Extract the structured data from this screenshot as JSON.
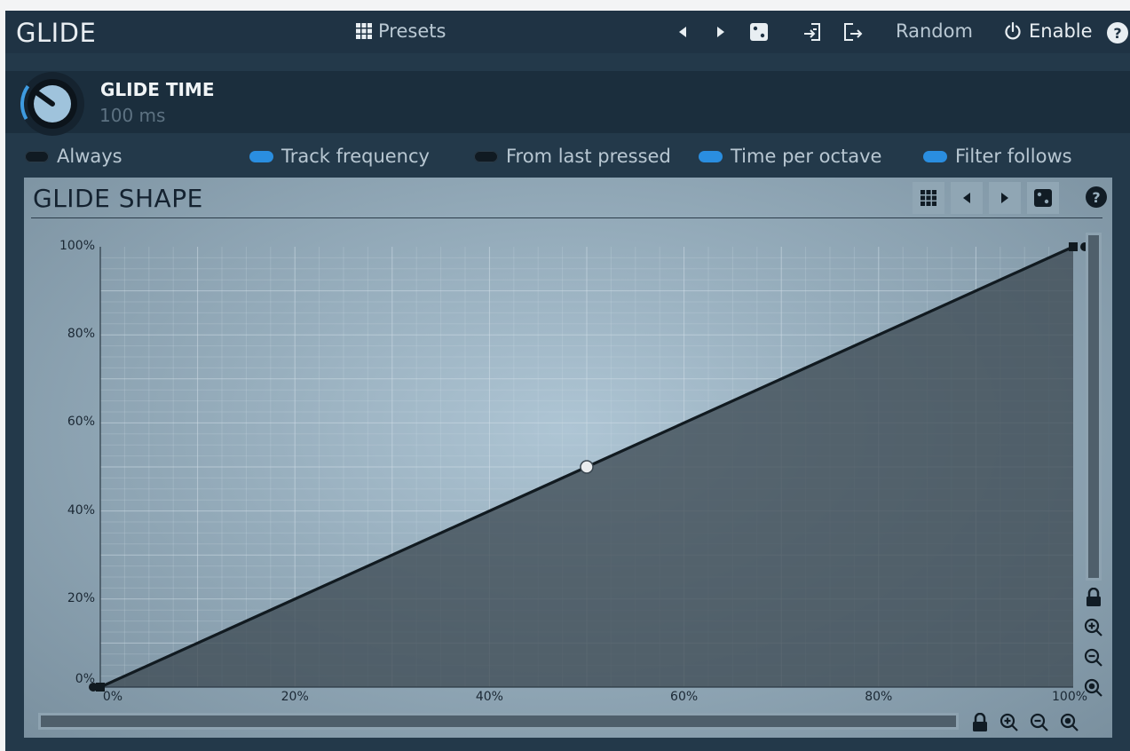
{
  "header": {
    "title": "GLIDE",
    "presets_label": "Presets",
    "random_label": "Random",
    "enable_label": "Enable",
    "help_label": "?"
  },
  "glide_time": {
    "label": "GLIDE TIME",
    "value": "100 ms",
    "knob_level": 0.22
  },
  "toggles": [
    {
      "label": "Always",
      "on": false
    },
    {
      "label": "Track frequency",
      "on": true
    },
    {
      "label": "From last pressed",
      "on": false
    },
    {
      "label": "Time per octave",
      "on": true
    },
    {
      "label": "Filter follows",
      "on": true
    }
  ],
  "glide_shape": {
    "title": "GLIDE SHAPE",
    "help_label": "?",
    "x_ticks": [
      "0%",
      "20%",
      "40%",
      "60%",
      "80%",
      "100%"
    ],
    "y_ticks": [
      "100%",
      "80%",
      "60%",
      "40%",
      "20%",
      "0%"
    ],
    "curve_points": [
      {
        "x": 0,
        "y": 0
      },
      {
        "x": 50,
        "y": 50
      },
      {
        "x": 100,
        "y": 100
      }
    ]
  },
  "colors": {
    "accent": "#2a8ee0",
    "background": "#23394a",
    "panel": "#9ab1c0"
  },
  "icons": {
    "presets": "grid-icon",
    "prev": "triangle-left-icon",
    "next": "triangle-right-icon",
    "random": "dice-icon",
    "import": "import-icon",
    "export": "export-icon",
    "power": "power-icon",
    "lock": "lock-icon",
    "zoom_in": "zoom-in-icon",
    "zoom_out": "zoom-out-icon",
    "zoom_reset": "zoom-reset-icon"
  }
}
